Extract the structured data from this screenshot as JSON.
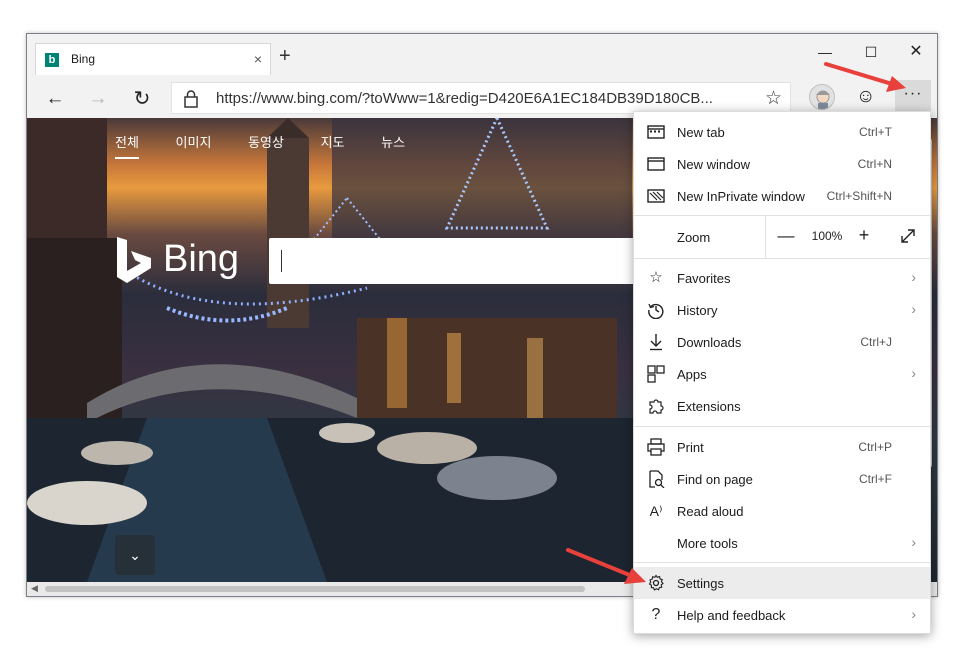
{
  "tab": {
    "title": "Bing",
    "favicon": "b",
    "close": "×",
    "new_tab": "+"
  },
  "window_controls": {
    "minimize": "—",
    "maximize": "☐",
    "close": "✕"
  },
  "toolbar": {
    "back": "←",
    "forward": "→",
    "refresh": "↻",
    "url": "https://www.bing.com/?toWww=1&redig=D420E6A1EC184DB39D180CB...",
    "favorite_star": "☆",
    "feedback_smiley": "☺",
    "more": "···"
  },
  "bing": {
    "tabs": [
      "전체",
      "이미지",
      "동영상",
      "지도",
      "뉴스"
    ],
    "logo_text": "Bing",
    "search_placeholder": "",
    "scroll_down": "⌄"
  },
  "menu": {
    "new_tab": {
      "label": "New tab",
      "shortcut": "Ctrl+T"
    },
    "new_window": {
      "label": "New window",
      "shortcut": "Ctrl+N"
    },
    "new_inprivate": {
      "label": "New InPrivate window",
      "shortcut": "Ctrl+Shift+N"
    },
    "zoom": {
      "label": "Zoom",
      "minus": "—",
      "value": "100%",
      "plus": "+"
    },
    "favorites": {
      "label": "Favorites"
    },
    "history": {
      "label": "History"
    },
    "downloads": {
      "label": "Downloads",
      "shortcut": "Ctrl+J"
    },
    "apps": {
      "label": "Apps"
    },
    "extensions": {
      "label": "Extensions"
    },
    "print": {
      "label": "Print",
      "shortcut": "Ctrl+P"
    },
    "find_on_page": {
      "label": "Find on page",
      "shortcut": "Ctrl+F"
    },
    "read_aloud": {
      "label": "Read aloud",
      "shortcut": ""
    },
    "more_tools": {
      "label": "More tools"
    },
    "settings": {
      "label": "Settings"
    },
    "help_feedback": {
      "label": "Help and feedback"
    }
  },
  "colors": {
    "annotation_arrow": "#e8403a",
    "bing_teal": "#008373",
    "menu_highlight": "#ececec"
  }
}
